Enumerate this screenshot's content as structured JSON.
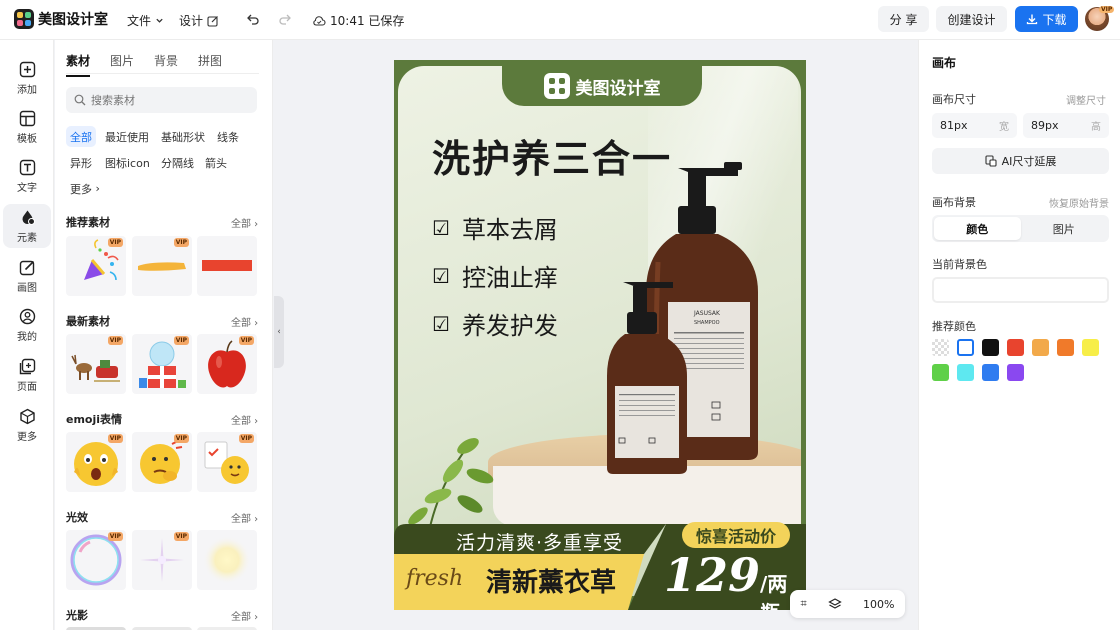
{
  "topbar": {
    "app_name": "美图设计室",
    "menu_file": "文件",
    "menu_design": "设计",
    "save_status": "10:41 已保存",
    "share_label": "分 享",
    "create_label": "创建设计",
    "download_label": "下载",
    "avatar_badge": "VIP"
  },
  "leftnav": {
    "items": [
      {
        "label": "添加"
      },
      {
        "label": "模板"
      },
      {
        "label": "文字"
      },
      {
        "label": "元素"
      },
      {
        "label": "画图"
      },
      {
        "label": "我的"
      },
      {
        "label": "页面"
      },
      {
        "label": "更多"
      }
    ]
  },
  "panel": {
    "tabs": [
      "素材",
      "图片",
      "背景",
      "拼图"
    ],
    "search_placeholder": "搜索素材",
    "chips": [
      "全部",
      "最近使用",
      "基础形状",
      "线条",
      "异形",
      "图标icon",
      "分隔线",
      "箭头",
      "更多"
    ],
    "sections": [
      {
        "title": "推荐素材",
        "all": "全部"
      },
      {
        "title": "最新素材",
        "all": "全部"
      },
      {
        "title": "emoji表情",
        "all": "全部"
      },
      {
        "title": "光效",
        "all": "全部"
      },
      {
        "title": "光影",
        "all": "全部"
      }
    ],
    "vip_badge": "VIP"
  },
  "poster": {
    "logo_text": "美图设计室",
    "title": "洗护养三合一",
    "features": [
      "草本去屑",
      "控油止痒",
      "养发护发"
    ],
    "slogan": "活力清爽·多重享受",
    "promo_tag": "惊喜活动价",
    "script_text": "fresh",
    "product_name": "清新薰衣草",
    "price": "129",
    "price_unit": "/两瓶",
    "label_big": "JASUSAK",
    "label_sub": "SHAMPOO"
  },
  "zoom": {
    "value": "100%"
  },
  "rpanel": {
    "title": "画布",
    "size_label": "画布尺寸",
    "adjust_size": "调整尺寸",
    "width_value": "81px",
    "width_unit": "宽",
    "height_value": "89px",
    "height_unit": "高",
    "ai_extend": "AI尺寸延展",
    "bg_label": "画布背景",
    "restore_bg": "恢复原始背景",
    "seg_color": "颜色",
    "seg_image": "图片",
    "current_bg": "当前背景色",
    "recommend": "推荐颜色",
    "swatches": [
      "transparent",
      "#ffffff",
      "#111111",
      "#e8442e",
      "#f2a94a",
      "#f07a2a",
      "#f7ee48",
      "#5fd048",
      "#5ee8f0",
      "#2f7cf0",
      "#8a48f0"
    ]
  },
  "colors": {
    "accent": "#1a73f0",
    "poster_green": "#5c7a3c",
    "band_dark": "#3a4a1e",
    "band_yellow": "#f3d35a"
  }
}
